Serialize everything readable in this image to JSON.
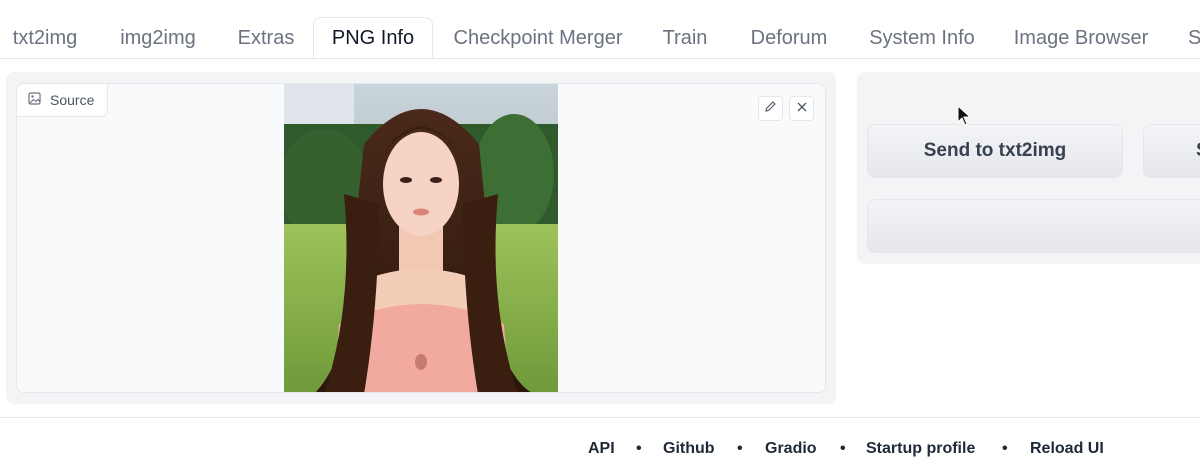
{
  "tabs": [
    {
      "label": "txt2img"
    },
    {
      "label": "img2img"
    },
    {
      "label": "Extras"
    },
    {
      "label": "PNG Info"
    },
    {
      "label": "Checkpoint Merger"
    },
    {
      "label": "Train"
    },
    {
      "label": "Deforum"
    },
    {
      "label": "System Info"
    },
    {
      "label": "Image Browser"
    },
    {
      "label": "S"
    }
  ],
  "active_tab": "PNG Info",
  "image_panel": {
    "source_label": "Source",
    "source_icon": "image-icon",
    "edit_icon": "pencil-icon",
    "clear_icon": "close-icon"
  },
  "actions": {
    "send_txt2img_label": "Send to txt2img",
    "send_img2img_label": "S"
  },
  "footer": {
    "links": [
      "API",
      "Github",
      "Gradio",
      "Startup profile",
      "Reload UI"
    ],
    "separator": "•"
  },
  "colors": {
    "accent_border": "#e5e7eb",
    "panel_bg": "#f3f4f6",
    "button_bg": "#e5e7eb",
    "text_primary": "#1f2937",
    "text_muted": "#6b7280"
  }
}
